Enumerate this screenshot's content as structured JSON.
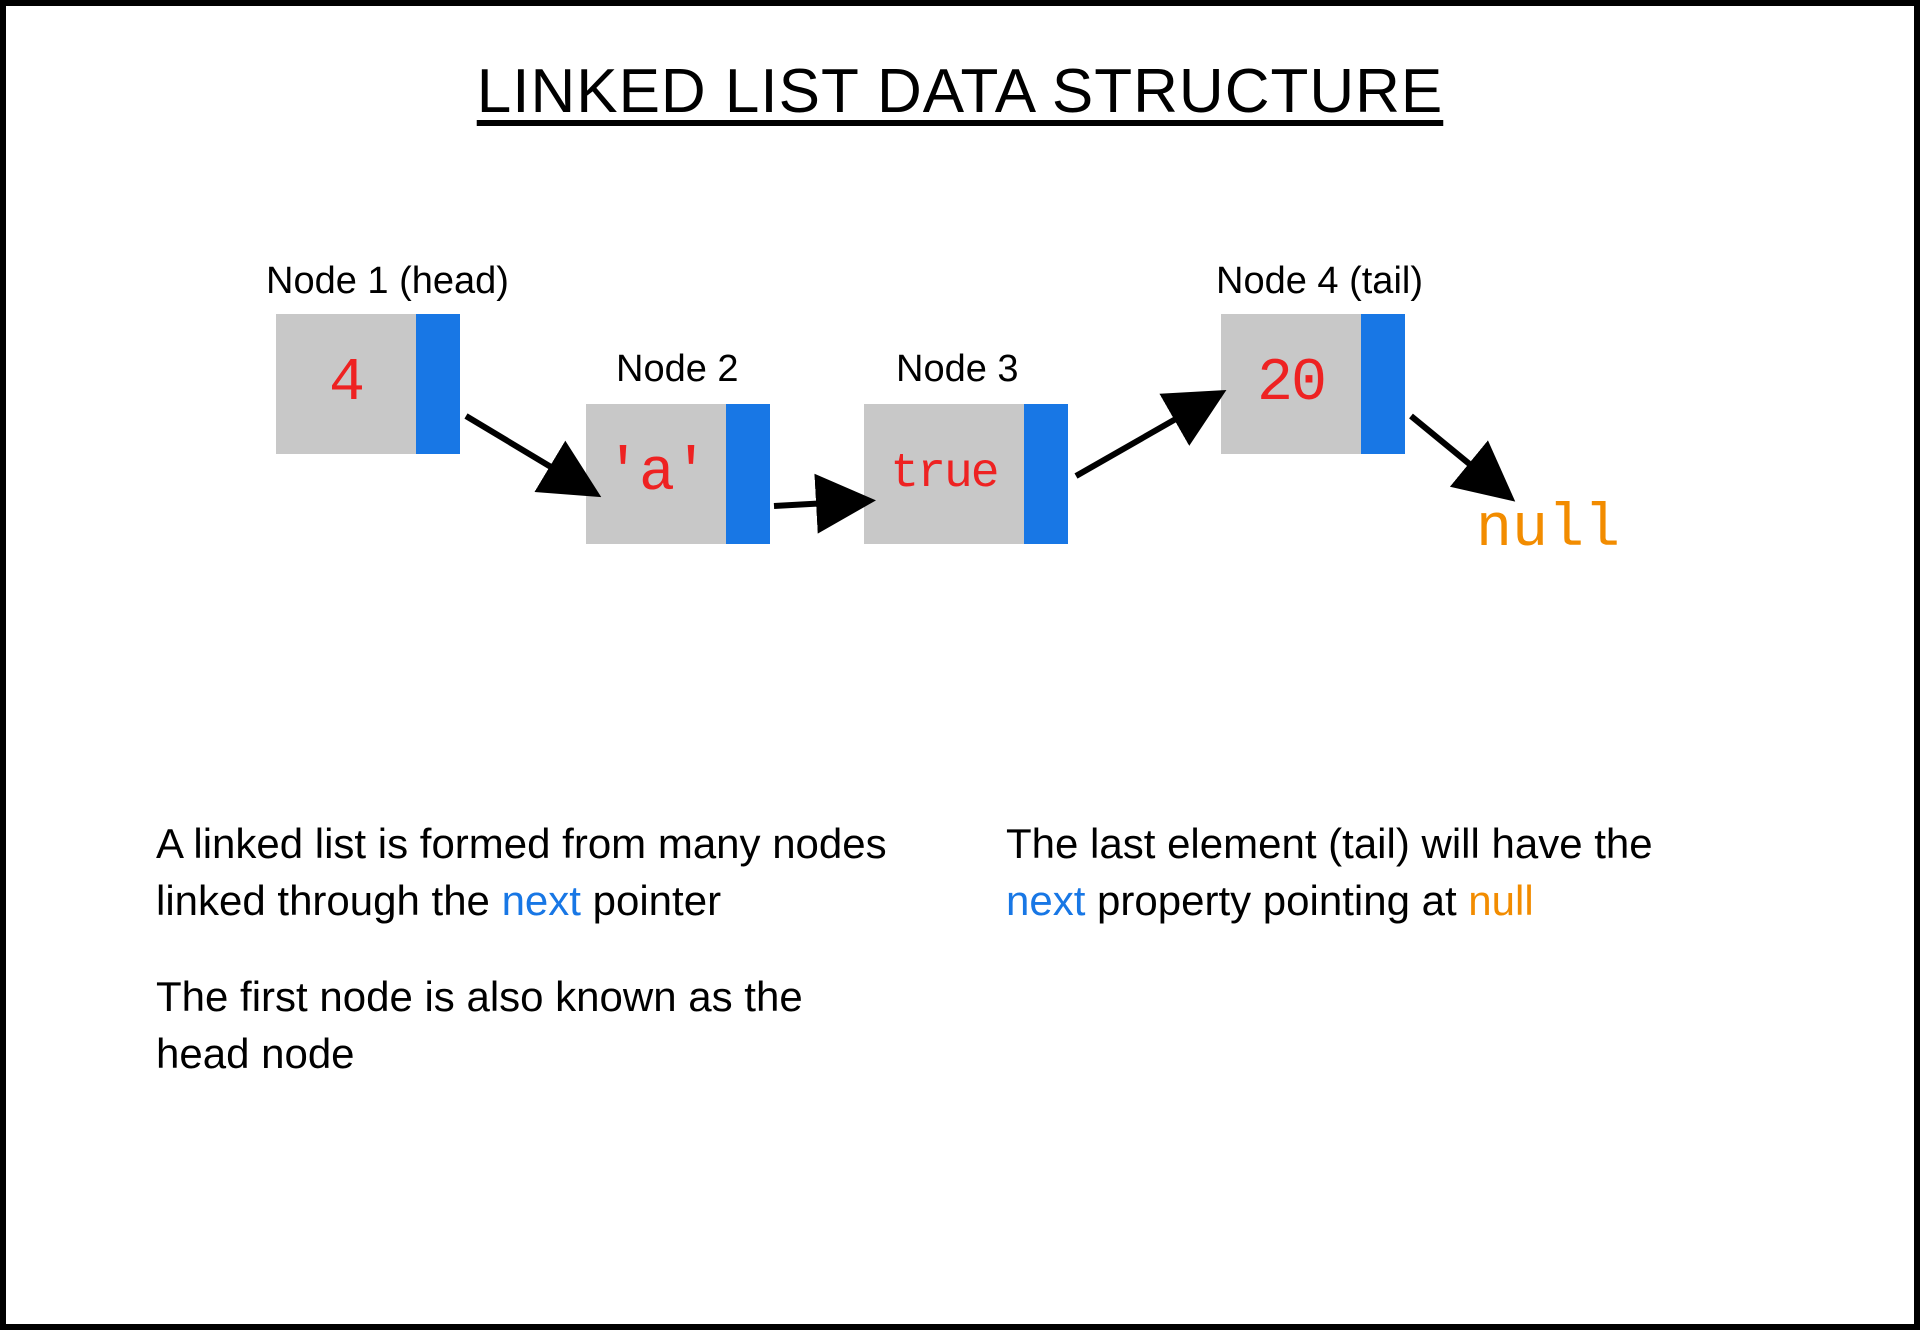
{
  "title": "LINKED LIST DATA STRUCTURE",
  "nodes": [
    {
      "label": "Node 1 (head)",
      "value": "4"
    },
    {
      "label": "Node 2",
      "value": "'a'"
    },
    {
      "label": "Node 3",
      "value": "true"
    },
    {
      "label": "Node 4 (tail)",
      "value": "20"
    }
  ],
  "null_label": "null",
  "desc_left": {
    "p1_a": "A linked list is formed from many nodes linked through the ",
    "p1_next": "next",
    "p1_b": " pointer",
    "p2": "The first node is also known as the head node"
  },
  "desc_right": {
    "p1_a": "The last element (tail) will have the ",
    "p1_next": "next",
    "p1_b": " property pointing at ",
    "p1_null": "null"
  },
  "colors": {
    "node_bg": "#c8c8c8",
    "pointer_bg": "#1877e5",
    "value_color": "#e22",
    "null_color": "#f28c00"
  }
}
